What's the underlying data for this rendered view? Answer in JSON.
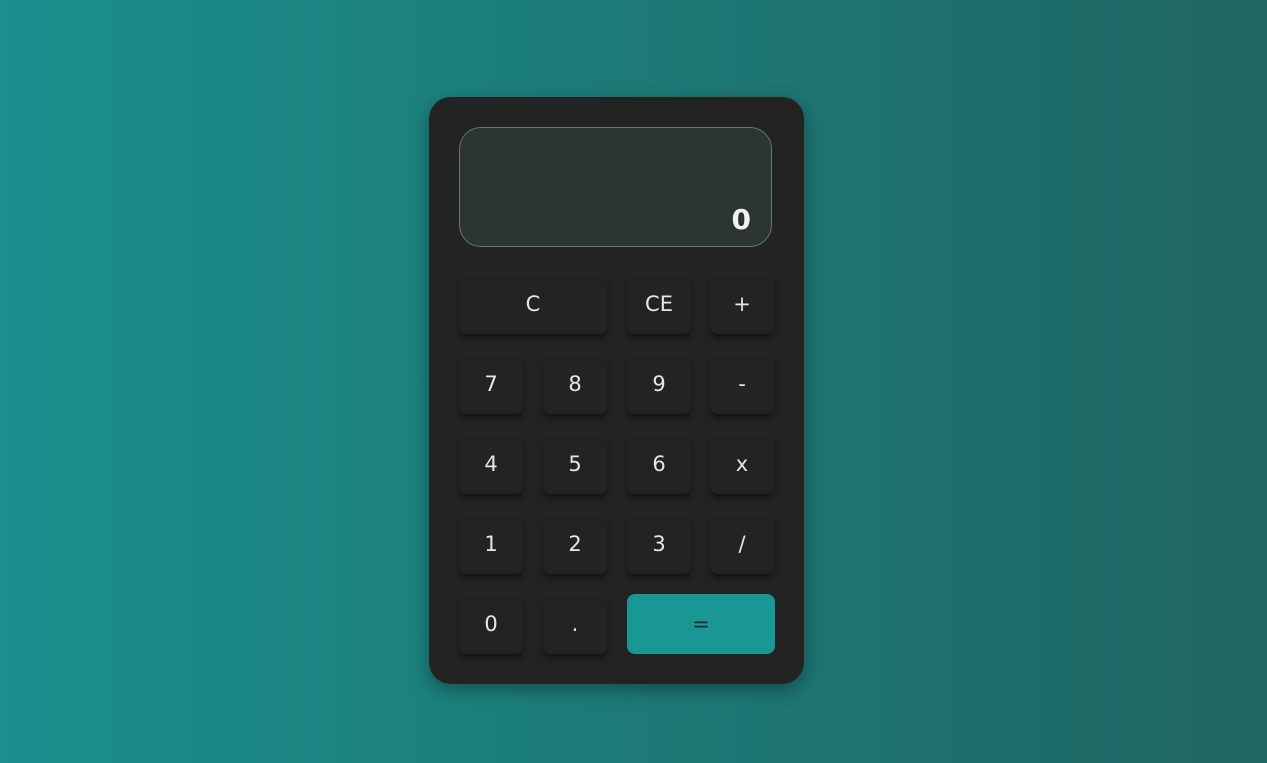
{
  "display": {
    "value": "0"
  },
  "keys": {
    "clear": "C",
    "clear_entry": "CE",
    "add": "+",
    "seven": "7",
    "eight": "8",
    "nine": "9",
    "subtract": "-",
    "four": "4",
    "five": "5",
    "six": "6",
    "multiply": "x",
    "one": "1",
    "two": "2",
    "three": "3",
    "divide": "/",
    "zero": "0",
    "decimal": ".",
    "equals": "="
  },
  "colors": {
    "background_start": "#1a8f8d",
    "background_end": "#1f6563",
    "body": "#232323",
    "display_bg": "#2a3534",
    "accent": "#189794"
  }
}
